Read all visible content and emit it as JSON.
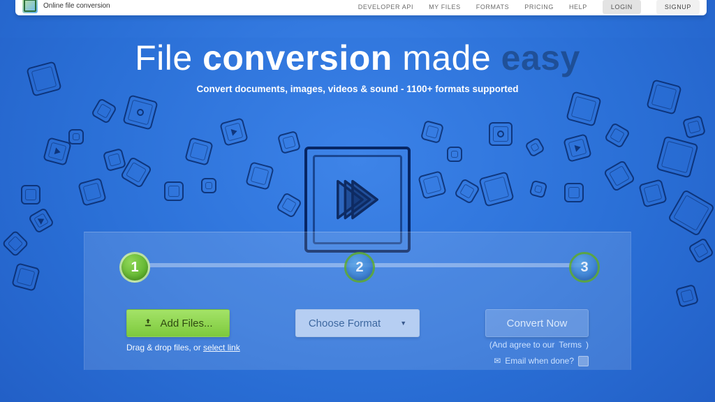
{
  "brand": {
    "tagline": "Online file conversion"
  },
  "nav": {
    "items": [
      "DEVELOPER API",
      "MY FILES",
      "FORMATS",
      "PRICING",
      "HELP"
    ],
    "login": "LOGIN",
    "signup": "SIGNUP"
  },
  "hero": {
    "title_1": "File ",
    "title_2": "conversion",
    "title_3": " made ",
    "title_4": "easy",
    "subtitle": "Convert documents, images, videos & sound - 1100+ formats supported"
  },
  "steps": {
    "one": "1",
    "two": "2",
    "three": "3",
    "active_index": 1
  },
  "controls": {
    "add_label": "Add Files...",
    "drag_hint_prefix": "Drag & drop files, or ",
    "drag_hint_link": "select link",
    "format_label": "Choose Format",
    "convert_label": "Convert Now",
    "agree_prefix": "(And agree to our ",
    "agree_link": "Terms",
    "agree_suffix": ")",
    "email_label": "Email when done?"
  },
  "colors": {
    "accent_green": "#7dc93d",
    "bg_blue": "#2a6fd6"
  }
}
